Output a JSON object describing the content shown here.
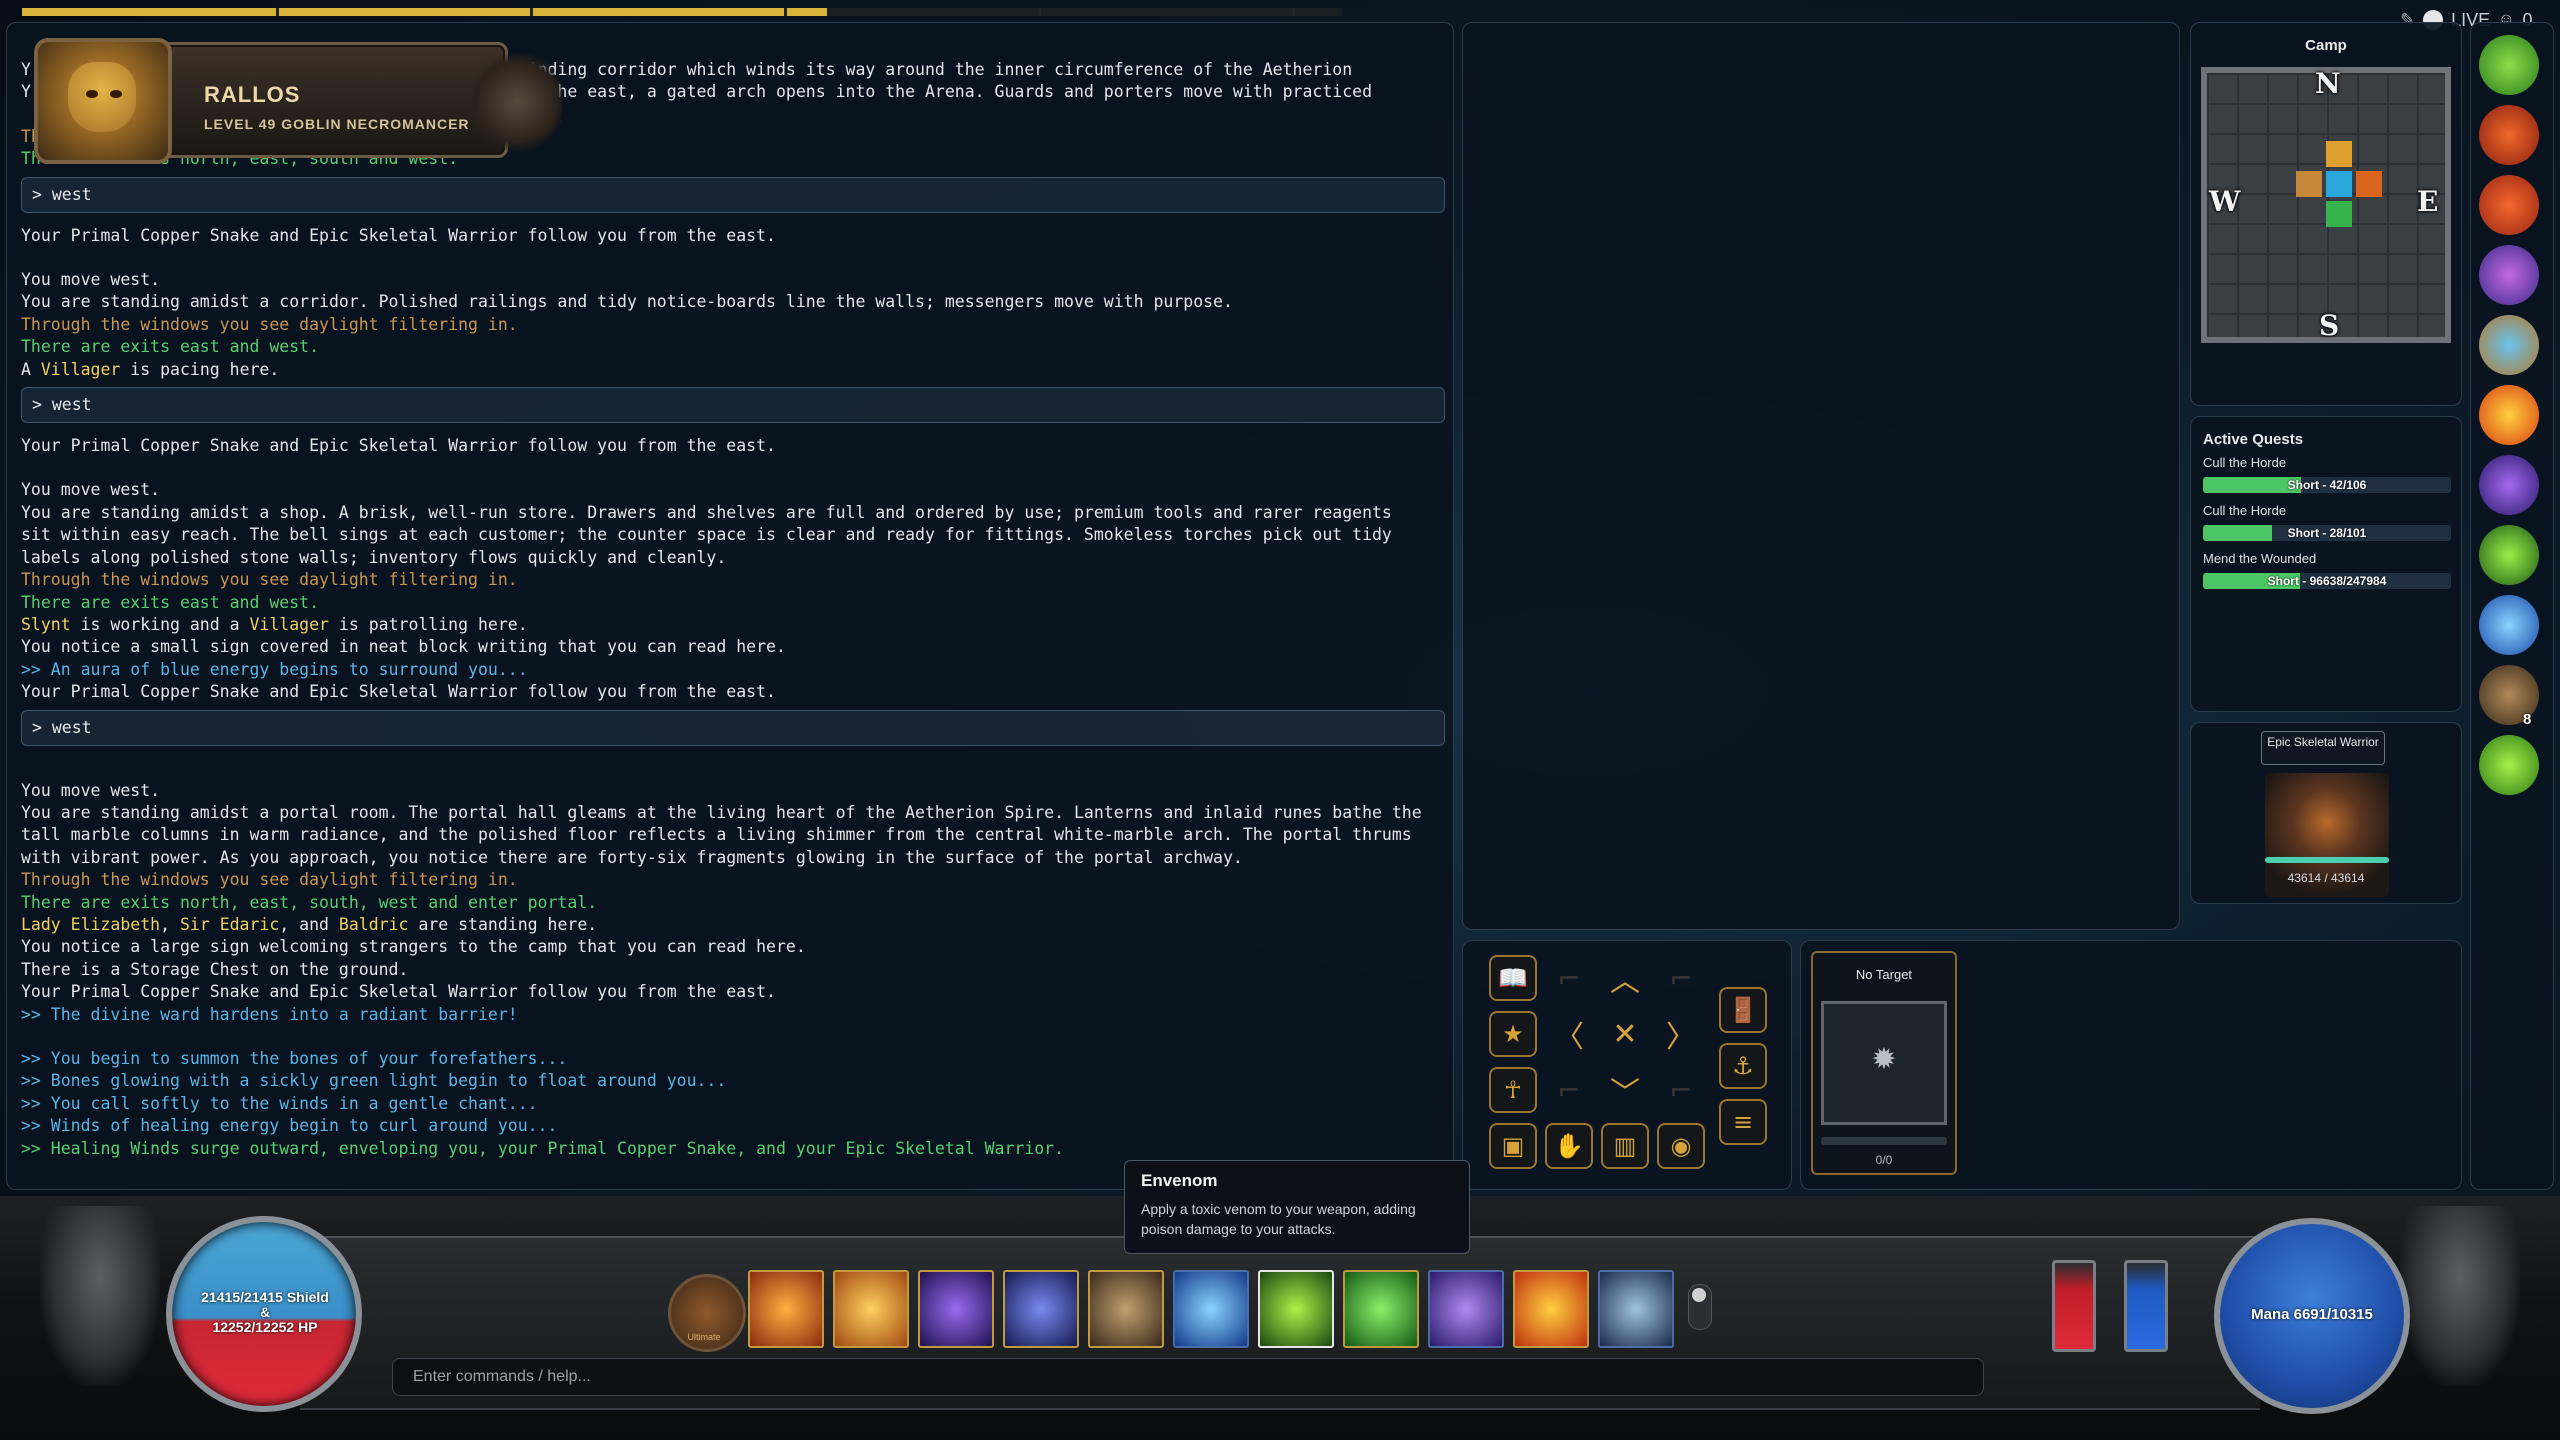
{
  "top_progress": {
    "fraction": 0.61
  },
  "live": {
    "label": "LIVE",
    "count": "0"
  },
  "character": {
    "name": "RALLOS",
    "subtitle": "LEVEL 49  GOBLIN  NECROMANCER"
  },
  "log": {
    "lines": [
      {
        "type": "text",
        "color": "white",
        "text": "Y                                                 winding corridor which winds its way around the inner circumference of the Aetherion"
      },
      {
        "type": "text",
        "color": "white",
        "text": "Y                                                 To the east, a gated arch opens into the Arena. Guards and porters move with practiced"
      },
      {
        "type": "gap"
      },
      {
        "type": "text",
        "color": "orange",
        "text": "Through the windows you see daylight filtering in."
      },
      {
        "type": "text",
        "color": "green",
        "text": "There are exits north, east, south and west."
      },
      {
        "type": "cmd",
        "text": "> west"
      },
      {
        "type": "text",
        "color": "white",
        "text": "Your Primal Copper Snake and Epic Skeletal Warrior follow you from the east."
      },
      {
        "type": "gap"
      },
      {
        "type": "text",
        "color": "white",
        "text": "You move west."
      },
      {
        "type": "text",
        "color": "white",
        "text": "You are standing amidst a corridor. Polished railings and tidy notice-boards line the walls; messengers move with purpose."
      },
      {
        "type": "text",
        "color": "orange",
        "text": "Through the windows you see daylight filtering in."
      },
      {
        "type": "text",
        "color": "green",
        "text": "There are exits east and west."
      },
      {
        "type": "rich",
        "parts": [
          {
            "c": "white",
            "t": "A "
          },
          {
            "c": "yellow",
            "t": "Villager"
          },
          {
            "c": "white",
            "t": " is pacing here."
          }
        ]
      },
      {
        "type": "cmd",
        "text": "> west"
      },
      {
        "type": "text",
        "color": "white",
        "text": "Your Primal Copper Snake and Epic Skeletal Warrior follow you from the east."
      },
      {
        "type": "gap"
      },
      {
        "type": "text",
        "color": "white",
        "text": "You move west."
      },
      {
        "type": "text",
        "color": "white",
        "text": "You are standing amidst a shop. A brisk, well-run store. Drawers and shelves are full and ordered by use; premium tools and rarer reagents"
      },
      {
        "type": "text",
        "color": "white",
        "text": "sit within easy reach. The bell sings at each customer; the counter space is clear and ready for fittings. Smokeless torches pick out tidy"
      },
      {
        "type": "text",
        "color": "white",
        "text": "labels along polished stone walls; inventory flows quickly and cleanly."
      },
      {
        "type": "text",
        "color": "orange",
        "text": "Through the windows you see daylight filtering in."
      },
      {
        "type": "text",
        "color": "green",
        "text": "There are exits east and west."
      },
      {
        "type": "rich",
        "parts": [
          {
            "c": "yellow",
            "t": "Slynt"
          },
          {
            "c": "white",
            "t": " is working and a "
          },
          {
            "c": "yellow",
            "t": "Villager"
          },
          {
            "c": "white",
            "t": " is patrolling here."
          }
        ]
      },
      {
        "type": "text",
        "color": "white",
        "text": "You notice a small sign covered in neat block writing that you can read here."
      },
      {
        "type": "text",
        "color": "blue",
        "text": ">> An aura of blue energy begins to surround you..."
      },
      {
        "type": "text",
        "color": "white",
        "text": "Your Primal Copper Snake and Epic Skeletal Warrior follow you from the east."
      },
      {
        "type": "cmd",
        "text": "> west"
      },
      {
        "type": "gap"
      },
      {
        "type": "text",
        "color": "white",
        "text": "You move west."
      },
      {
        "type": "text",
        "color": "white",
        "text": "You are standing amidst a portal room. The portal hall gleams at the living heart of the Aetherion Spire. Lanterns and inlaid runes bathe the"
      },
      {
        "type": "text",
        "color": "white",
        "text": "tall marble columns in warm radiance, and the polished floor reflects a living shimmer from the central white-marble arch. The portal thrums"
      },
      {
        "type": "text",
        "color": "white",
        "text": "with vibrant power. As you approach, you notice there are forty-six fragments glowing in the surface of the portal archway."
      },
      {
        "type": "text",
        "color": "orange",
        "text": "Through the windows you see daylight filtering in."
      },
      {
        "type": "text",
        "color": "green",
        "text": "There are exits north, east, south, west and enter portal."
      },
      {
        "type": "rich",
        "parts": [
          {
            "c": "yellow",
            "t": "Lady Elizabeth"
          },
          {
            "c": "white",
            "t": ", "
          },
          {
            "c": "yellow",
            "t": "Sir Edaric"
          },
          {
            "c": "white",
            "t": ", and "
          },
          {
            "c": "yellow",
            "t": "Baldric"
          },
          {
            "c": "white",
            "t": " are standing here."
          }
        ]
      },
      {
        "type": "text",
        "color": "white",
        "text": "You notice a large sign welcoming strangers to the camp that you can read here."
      },
      {
        "type": "text",
        "color": "white",
        "text": "There is a Storage Chest on the ground."
      },
      {
        "type": "text",
        "color": "white",
        "text": "Your Primal Copper Snake and Epic Skeletal Warrior follow you from the east."
      },
      {
        "type": "text",
        "color": "blue",
        "text": ">> The divine ward hardens into a radiant barrier!"
      },
      {
        "type": "gap"
      },
      {
        "type": "text",
        "color": "blue",
        "text": ">> You begin to summon the bones of your forefathers..."
      },
      {
        "type": "text",
        "color": "blue",
        "text": ">> Bones glowing with a sickly green light begin to float around you..."
      },
      {
        "type": "text",
        "color": "blue",
        "text": ">> You call softly to the winds in a gentle chant..."
      },
      {
        "type": "text",
        "color": "blue",
        "text": ">> Winds of healing energy begin to curl around you..."
      },
      {
        "type": "text",
        "color": "green",
        "text": ">> Healing Winds surge outward, enveloping you, your Primal Copper Snake, and your Epic Skeletal Warrior."
      }
    ]
  },
  "camp": {
    "title": "Camp",
    "compass": {
      "n": "N",
      "s": "S",
      "e": "E",
      "w": "W"
    }
  },
  "quests": {
    "title": "Active Quests",
    "items": [
      {
        "name": "Cull the Horde",
        "progress": "Short - 42/106",
        "fraction": 0.396
      },
      {
        "name": "Cull the Horde",
        "progress": "Short - 28/101",
        "fraction": 0.277
      },
      {
        "name": "Mend the Wounded",
        "progress": "Short - 96638/247984",
        "fraction": 0.39
      }
    ]
  },
  "pet": {
    "name": "Epic Skeletal Warrior",
    "hp": "43614 / 43614",
    "hp_fraction": 1.0
  },
  "right_column": {
    "icons": [
      "heal-plus-icon",
      "fire-sword-icon",
      "fire-crest-icon",
      "crystal-gems-icon",
      "blue-book-icon",
      "fire-orb-icon",
      "violet-shield-icon",
      "green-leaf-icon",
      "blue-ward-icon",
      "skeleton-summon-icon",
      "green-wind-icon"
    ],
    "summon_count": "8"
  },
  "directions": {
    "glyphs": {
      "up": "︿",
      "down": "﹀",
      "left": "〈",
      "right": "〉",
      "center": "✕",
      "corner": "⌐"
    }
  },
  "target": {
    "label": "No Target",
    "count": "0/0"
  },
  "tooltip": {
    "title": "Envenom",
    "description": "Apply a toxic venom to your weapon, adding poison damage to your attacks."
  },
  "vitals": {
    "shield": "21415/21415 Shield",
    "amp": "&",
    "hp": "12252/12252 HP",
    "mana": "Mana 6691/10315",
    "mana_fraction": 0.65
  },
  "hotbar": {
    "ultimate_label": "Ultimate",
    "slots": [
      "fire-burst-icon",
      "flame-blade-icon",
      "shadow-claw-icon",
      "void-strike-icon",
      "warrior-shield-icon",
      "blue-ward-icon",
      "envenom-icon",
      "green-wind-icon",
      "violet-shield-icon",
      "fire-orb-icon",
      "skeleton-summon-icon"
    ]
  },
  "input": {
    "placeholder": "Enter commands / help..."
  },
  "colors": {
    "gold": "#d9b43a",
    "green": "#56d06e",
    "blue": "#5bb4e6",
    "orange": "#c99652",
    "yellow": "#f0d15c"
  }
}
